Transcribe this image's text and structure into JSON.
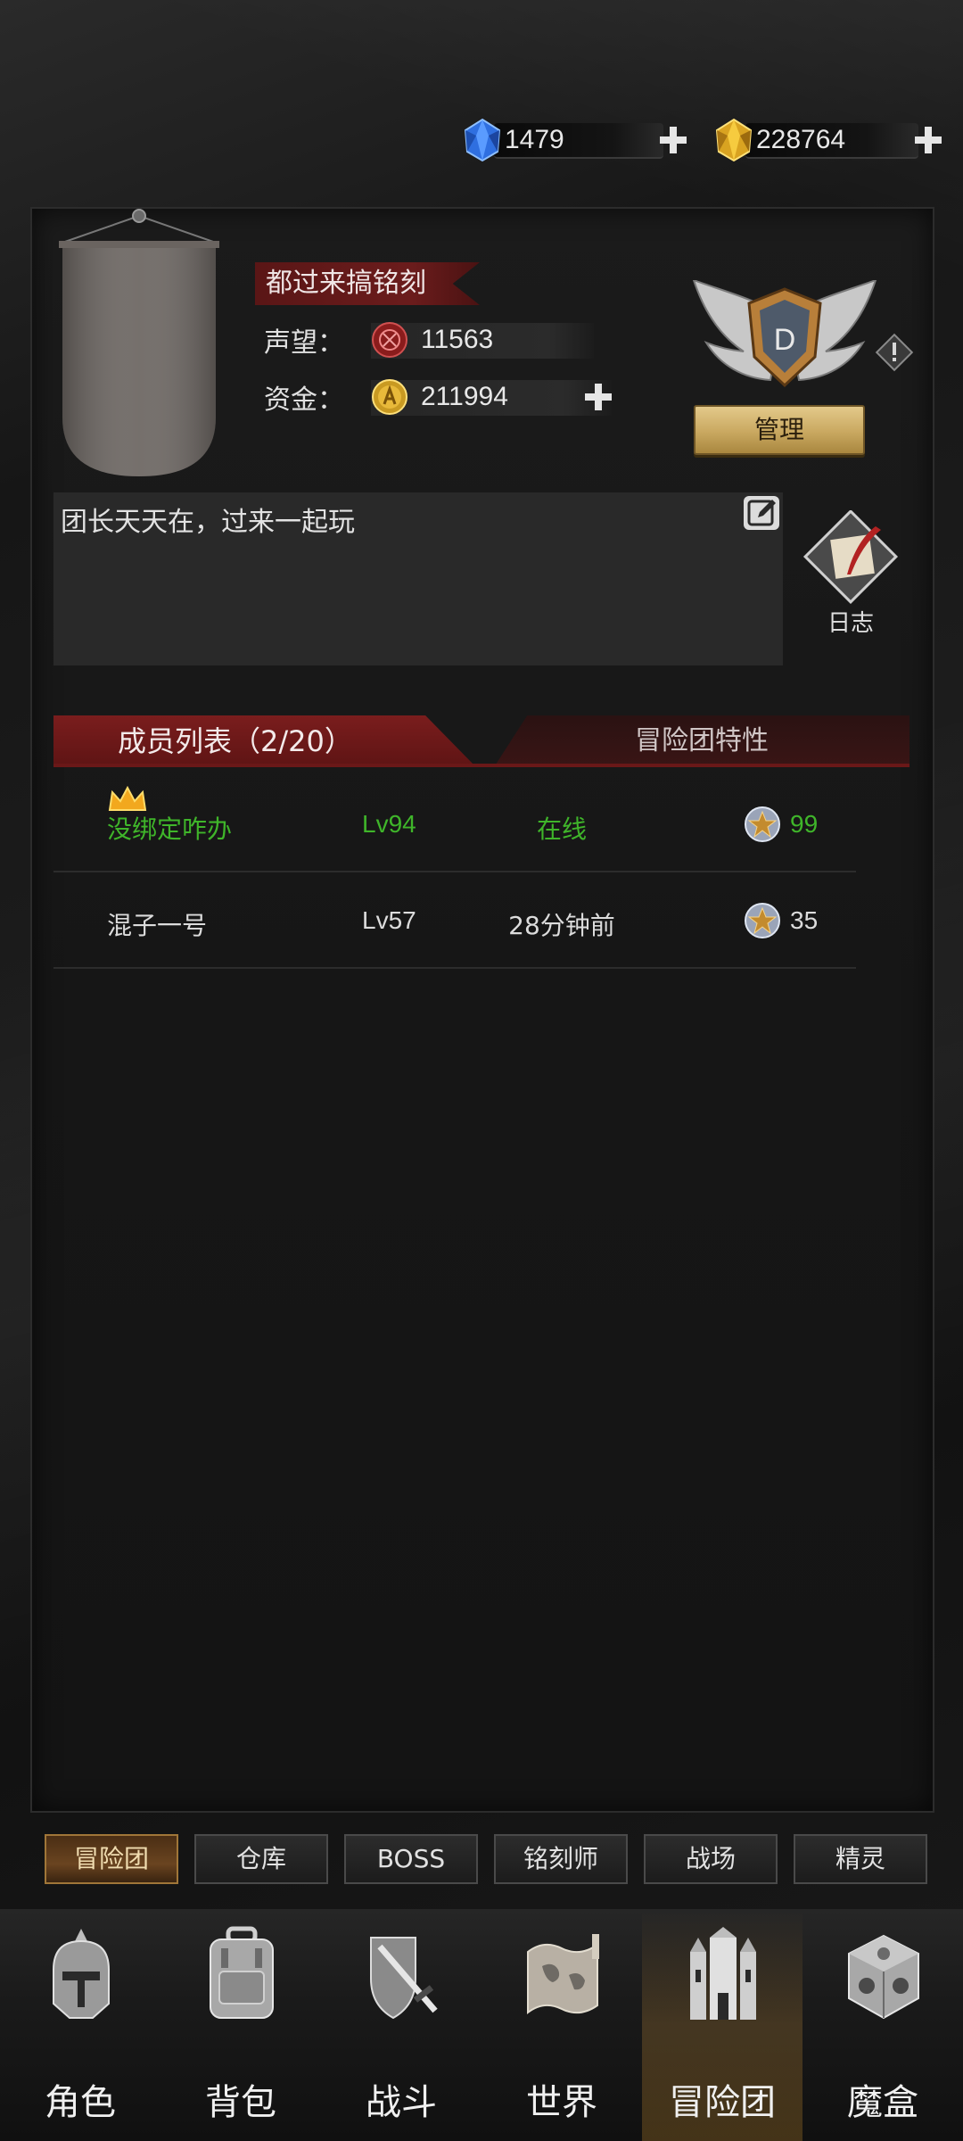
{
  "currency": {
    "gems": "1479",
    "gold": "228764"
  },
  "guild": {
    "name": "都过来搞铭刻",
    "reputation_label": "声望：",
    "reputation_value": "11563",
    "funds_label": "资金：",
    "funds_value": "211994",
    "rank_letter": "D",
    "manage_label": "管理",
    "motto": "团长天天在，过来一起玩",
    "log_label": "日志"
  },
  "tabs": {
    "members_label": "成员列表（2/20）",
    "traits_label": "冒险团特性"
  },
  "members": [
    {
      "name": "没绑定咋办",
      "level": "Lv94",
      "status": "在线",
      "points": "99",
      "leader": true,
      "online": true
    },
    {
      "name": "混子一号",
      "level": "Lv57",
      "status": "28分钟前",
      "points": "35",
      "leader": false,
      "online": false
    }
  ],
  "subtabs": [
    "冒险团",
    "仓库",
    "BOSS",
    "铭刻师",
    "战场",
    "精灵"
  ],
  "nav": [
    "角色",
    "背包",
    "战斗",
    "世界",
    "冒险团",
    "魔盒"
  ],
  "colors": {
    "online_green": "#3fb52a",
    "tab_red": "#7a1d1d",
    "manage_gold": "#c9a860",
    "active_gold": "#a07638"
  },
  "icons": {
    "gem": "blue-gem-icon",
    "gold": "gold-gem-icon",
    "reputation": "reputation-emblem-icon",
    "funds": "gold-coin-icon",
    "rank": "winged-shield-icon",
    "edit": "edit-icon",
    "log": "scroll-quill-icon",
    "leader": "crown-icon",
    "points": "star-medal-icon"
  }
}
